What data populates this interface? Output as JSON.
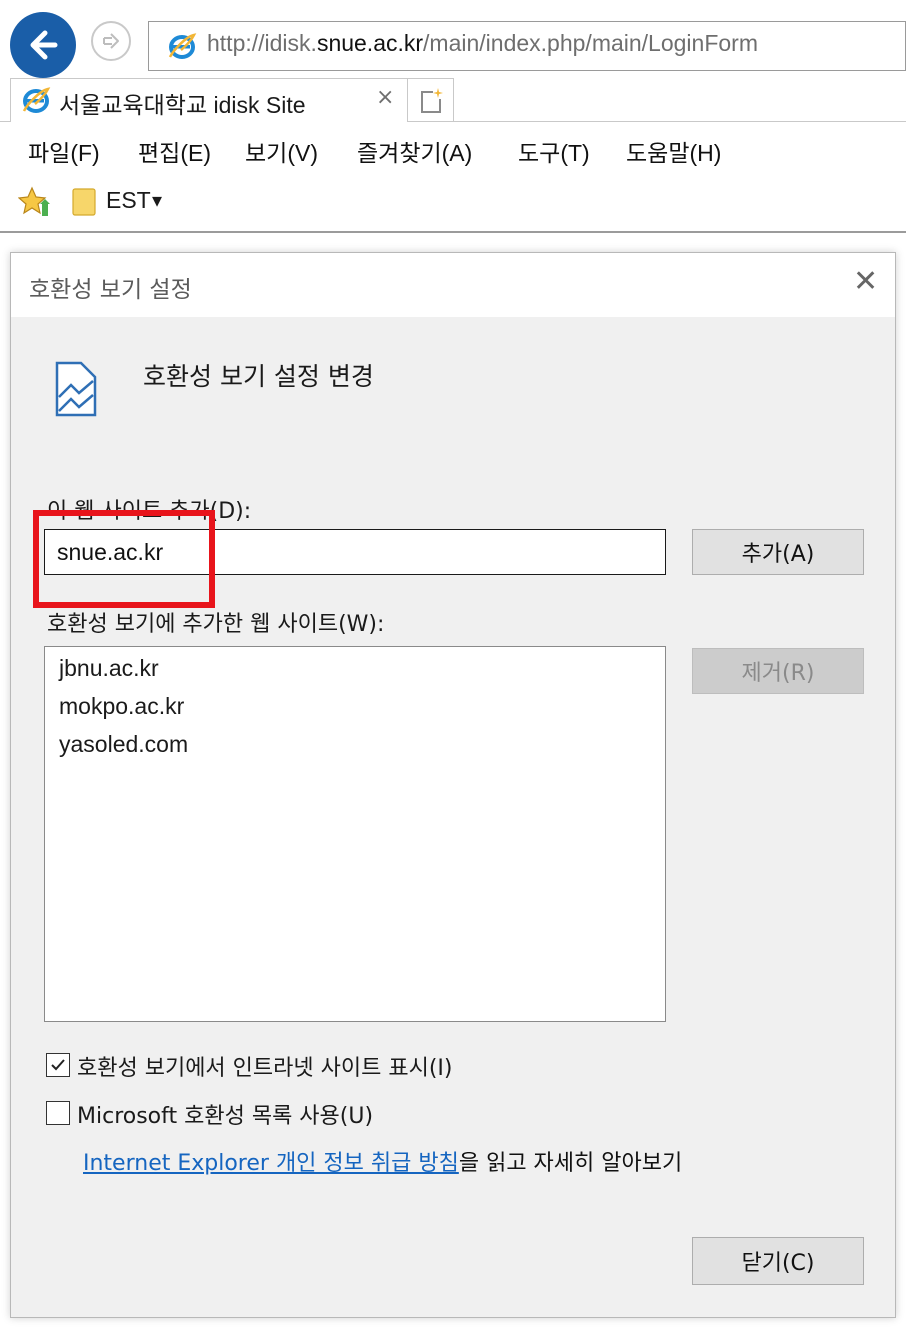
{
  "browser": {
    "address": {
      "prefix": "http://idisk.",
      "domain": "snue.ac.kr",
      "path": "/main/index.php/main/LoginForm"
    },
    "tab": {
      "title": "서울교육대학교 idisk Site",
      "close_glyph": "×"
    },
    "menu": [
      "파일(F)",
      "편집(E)",
      "보기(V)",
      "즐겨찾기(A)",
      "도구(T)",
      "도움말(H)"
    ],
    "favorites": {
      "folder_label": "EST",
      "dropdown_glyph": "▾"
    }
  },
  "dialog": {
    "title": "호환성 보기 설정",
    "close_glyph": "✕",
    "header": "호환성 보기 설정 변경",
    "add_label": "이 웹 사이트 추가(D):",
    "input_value": "snue.ac.kr",
    "add_button": "추가(A)",
    "list_label": "호환성 보기에 추가한 웹 사이트(W):",
    "sites": [
      "jbnu.ac.kr",
      "mokpo.ac.kr",
      "yasoled.com"
    ],
    "remove_button": "제거(R)",
    "checkboxes": [
      {
        "label": "호환성 보기에서 인트라넷 사이트 표시(I)",
        "checked": true
      },
      {
        "label": "Microsoft 호환성 목록 사용(U)",
        "checked": false
      }
    ],
    "privacy_link": "Internet Explorer 개인 정보 취급 방침",
    "privacy_rest": "을 읽고 자세히 알아보기",
    "close_button": "닫기(C)"
  },
  "colors": {
    "highlight": "#e8141b",
    "link": "#1565c0",
    "back_button": "#1a5ea8"
  },
  "icons": [
    "back-arrow-icon",
    "forward-arrow-icon",
    "ie-logo-icon",
    "new-tab-icon",
    "favorites-star-icon",
    "folder-icon",
    "compatibility-view-icon"
  ]
}
